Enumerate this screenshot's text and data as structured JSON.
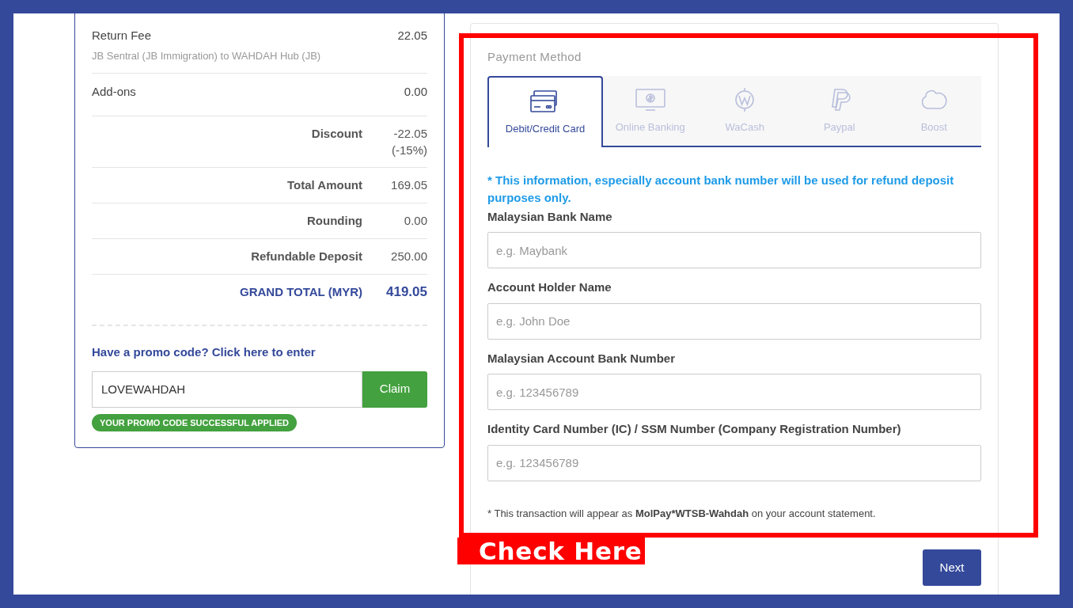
{
  "summary": {
    "rows": [
      {
        "kind": "item",
        "label": "Return Fee",
        "detail": "JB Sentral (JB Immigration) to WAHDAH Hub (JB)",
        "value": "22.05"
      },
      {
        "kind": "item",
        "label": "Add-ons",
        "value": "0.00"
      },
      {
        "kind": "total",
        "label": "Discount",
        "value": "-22.05 (-15%)"
      },
      {
        "kind": "total",
        "label": "Total Amount",
        "value": "169.05"
      },
      {
        "kind": "total",
        "label": "Rounding",
        "value": "0.00"
      },
      {
        "kind": "total",
        "label": "Refundable Deposit",
        "value": "250.00"
      },
      {
        "kind": "grand",
        "label": "GRAND TOTAL (MYR)",
        "value": "419.05"
      }
    ],
    "promo_link": "Have a promo code? Click here to enter",
    "promo_field": {
      "value": "LOVEWAHDAH"
    },
    "claim_button": "Claim",
    "promo_status": "YOUR PROMO CODE SUCCESSFUL APPLIED"
  },
  "payment": {
    "title": "Payment Method",
    "tabs": [
      {
        "kind": "card",
        "label": "Debit/Credit Card",
        "selected": true
      },
      {
        "kind": "banking",
        "label": "Online Banking",
        "selected": false
      },
      {
        "kind": "wacash",
        "label": "WaCash",
        "selected": false
      },
      {
        "kind": "paypal",
        "label": "Paypal",
        "selected": false
      },
      {
        "kind": "boost",
        "label": "Boost",
        "selected": false
      }
    ],
    "info": "* This information, especially account bank number will be used for refund deposit purposes only.",
    "fields": [
      {
        "label": "Malaysian Bank Name",
        "placeholder": "e.g. Maybank"
      },
      {
        "label": "Account Holder Name",
        "placeholder": "e.g. John Doe"
      },
      {
        "label": "Malaysian Account Bank Number",
        "placeholder": "e.g. 123456789"
      },
      {
        "label": "Identity Card Number (IC) / SSM Number (Company Registration Number)",
        "placeholder": "e.g. 123456789"
      }
    ],
    "note": "* This transaction will appear as **MolPay*WTSB-Wahdah** on your account statement.",
    "next_button": "Next"
  },
  "annotation": {
    "label": "Check Here"
  }
}
